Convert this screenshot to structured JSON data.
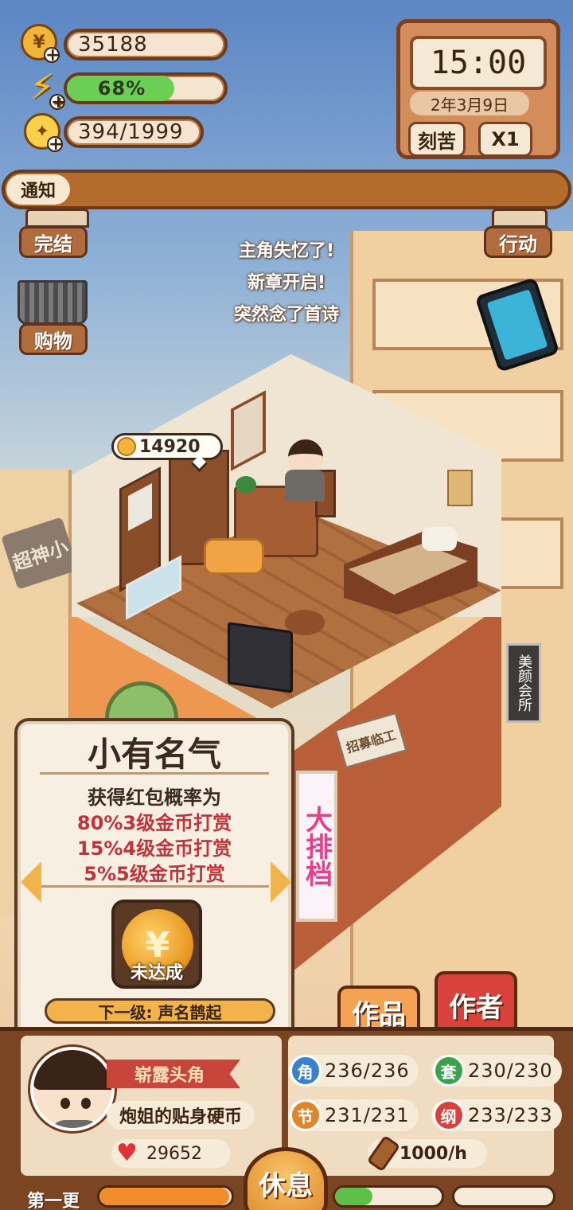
{
  "hud": {
    "coins": "35188",
    "energy_text": "68%",
    "energy_percent": 68,
    "inspiration": "394/1999"
  },
  "clock": {
    "time": "15:00",
    "date": "2年3月9日",
    "mode_button": "刻苦",
    "speed_button": "X1"
  },
  "notification": {
    "label": "通知",
    "message": ""
  },
  "side_buttons": {
    "complete": "完结",
    "shopping": "购物",
    "action": "行动"
  },
  "story_lines": [
    "主角失忆了!",
    "新章开启!",
    "突然念了首诗"
  ],
  "room": {
    "coin_bubble": "14920"
  },
  "scene_signs": {
    "shop": "超神小",
    "recruit": "招募临工",
    "big_stall": "大排档",
    "beauty": "美颜会所"
  },
  "info_card": {
    "title": "小有名气",
    "line1": "获得红包概率为",
    "line2": "80%3级金币打赏",
    "line3": "15%4级金币打赏",
    "line4": "5%5级金币打赏",
    "medal_status": "未达成",
    "next_level": "下一级: 声名鹊起"
  },
  "tabs": {
    "works": "作品",
    "author": "作者"
  },
  "profile": {
    "rank": "崭露头角",
    "item": "炮姐的贴身硬币",
    "likes": "29652"
  },
  "stats": [
    {
      "badge": "角",
      "value": "236/236",
      "color": "#3a7fd0"
    },
    {
      "badge": "套",
      "value": "230/230",
      "color": "#3aa24a"
    },
    {
      "badge": "节",
      "value": "231/231",
      "color": "#e0862a"
    },
    {
      "badge": "纲",
      "value": "233/233",
      "color": "#d9413a"
    }
  ],
  "income": "1000/h",
  "chapter": {
    "label": "第一更",
    "progress_left": 0.98,
    "progress_right": 0.35
  },
  "rest_button": "休息",
  "colors": {
    "accent_orange": "#f2b44a",
    "wood_brown": "#7b4422",
    "author_tab_red": "#d9413a",
    "energy_green": "#6ccf55"
  }
}
